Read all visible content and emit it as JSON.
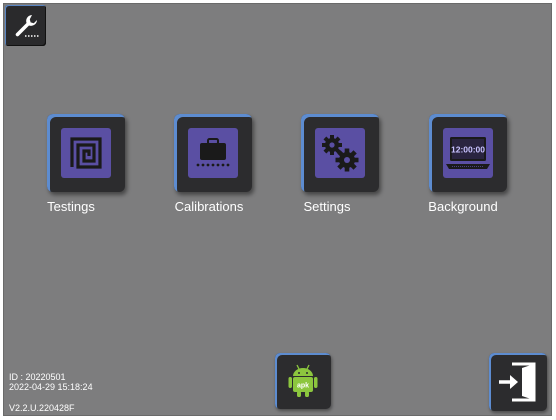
{
  "tiles": [
    {
      "label": "Testings",
      "icon": "spiral-square-icon"
    },
    {
      "label": "Calibrations",
      "icon": "suitcase-conveyor-icon"
    },
    {
      "label": "Settings",
      "icon": "gears-icon"
    },
    {
      "label": "Background",
      "icon": "laptop-clock-icon",
      "screen_text": "12:00:00"
    }
  ],
  "apk": {
    "label": "apk",
    "icon": "android-apk-icon"
  },
  "exit": {
    "icon": "exit-door-icon"
  },
  "tools": {
    "icon": "wrench-icon"
  },
  "info": {
    "id": "ID : 20220501",
    "datetime": "2022-04-29 15:18:24",
    "version": "V2.2.U.220428F"
  },
  "colors": {
    "background": "#7d7d7e",
    "tile": "#2c2c2e",
    "tile_face": "#5a4fa3",
    "accent": "#5d8cd0",
    "android_green": "#8cc63e"
  }
}
